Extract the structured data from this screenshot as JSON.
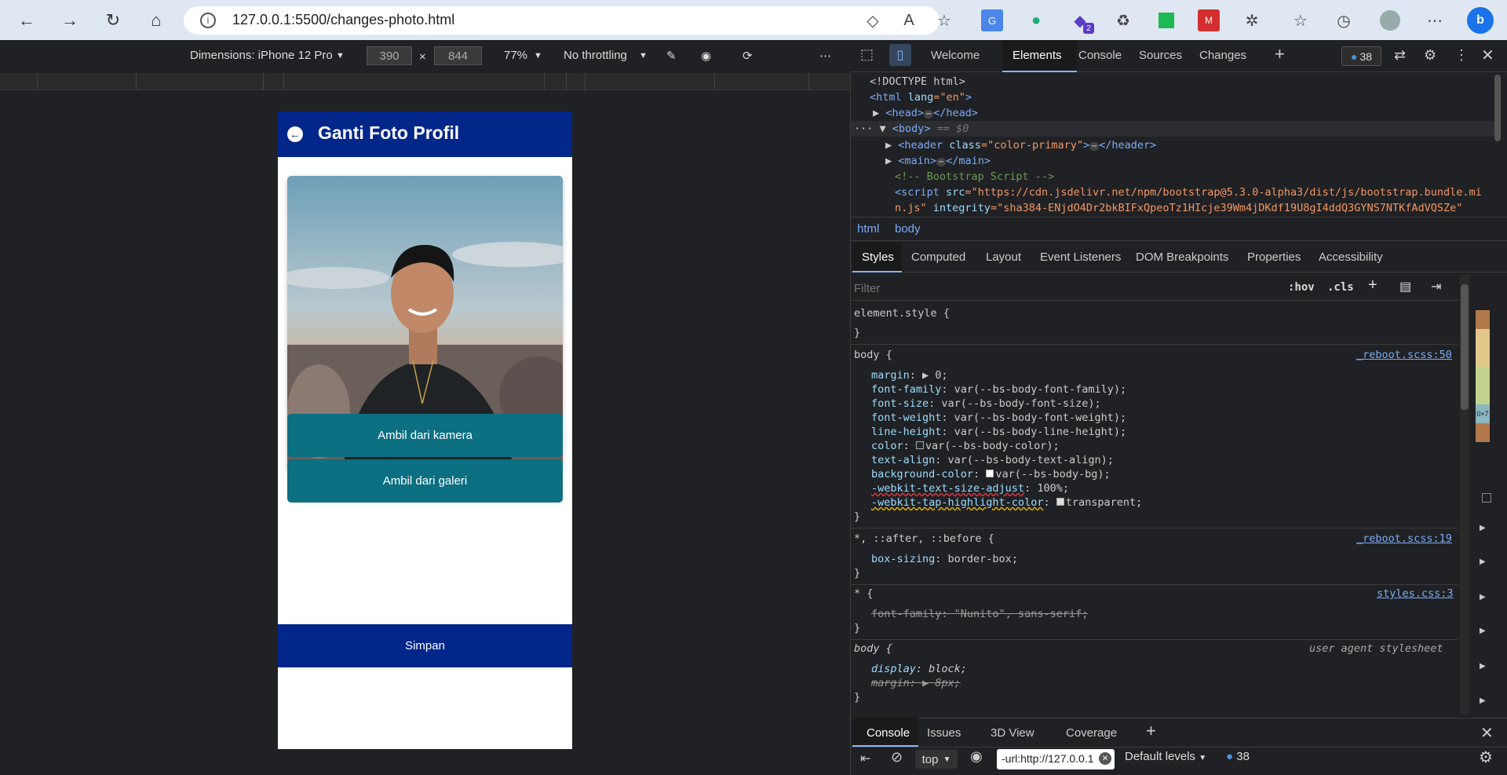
{
  "browser": {
    "url": "127.0.0.1:5500/changes-photo.html",
    "ext_badge": "2"
  },
  "devtoolbar": {
    "dimensions_label": "Dimensions: iPhone 12 Pro",
    "width": "390",
    "height": "844",
    "x": "×",
    "zoom": "77%",
    "throttling": "No throttling"
  },
  "phone": {
    "title": "Ganti Foto Profil",
    "btn_camera": "Ambil dari kamera",
    "btn_gallery": "Ambil dari galeri",
    "btn_save": "Simpan"
  },
  "devtools": {
    "tabs": [
      "Welcome",
      "Elements",
      "Console",
      "Sources",
      "Changes"
    ],
    "issues_count": "38",
    "dom_lines": {
      "l1": "<!DOCTYPE html>",
      "l2a": "<html ",
      "l2b": "lang",
      "l2c": "=\"en\"",
      "l2d": ">",
      "l3a": "<head>",
      "l3b": "</head>",
      "l4a": "<body>",
      "l4b": "== $0",
      "l5a": "<header ",
      "l5b": "class",
      "l5c": "=\"color-primary\"",
      "l5d": ">",
      "l5e": "</header>",
      "l6a": "<main>",
      "l6b": "</main>",
      "l7": "<!-- Bootstrap Script -->",
      "l8a": "<script ",
      "l8b": "src",
      "l8c": "=\"https://cdn.jsdelivr.net/npm/bootstrap@5.3.0-alpha3/dist/js/bootstrap.bundle.mi",
      "l9a": "n.js\" ",
      "l9b": "integrity",
      "l9c": "=\"sha384-ENjdO4Dr2bkBIFxQpeoTz1HIcje39Wm4jDKdf19U8gI4ddQ3GYNS7NTKfAdVQSZe\""
    },
    "crumbs": [
      "html",
      "body"
    ],
    "style_tabs": [
      "Styles",
      "Computed",
      "Layout",
      "Event Listeners",
      "DOM Breakpoints",
      "Properties",
      "Accessibility"
    ],
    "filter_placeholder": "Filter",
    "hov": ":hov",
    "cls": ".cls",
    "rules": {
      "r0a": "element.style {",
      "r0b": "}",
      "r1sel": "body {",
      "r1src": "_reboot.scss:50",
      "r1": [
        [
          "margin",
          ": ",
          "▶ 0;"
        ],
        [
          "font-family",
          ": ",
          "var(--bs-body-font-family);"
        ],
        [
          "font-size",
          ": ",
          "var(--bs-body-font-size);"
        ],
        [
          "font-weight",
          ": ",
          "var(--bs-body-font-weight);"
        ],
        [
          "line-height",
          ": ",
          "var(--bs-body-line-height);"
        ],
        [
          "color",
          ": ",
          "var(--bs-body-color);"
        ],
        [
          "text-align",
          ": ",
          "var(--bs-body-text-align);"
        ],
        [
          "background-color",
          ": ",
          "var(--bs-body-bg);"
        ],
        [
          "-webkit-text-size-adjust",
          ": ",
          "100%;"
        ],
        [
          "-webkit-tap-highlight-color",
          ": ",
          "transparent;"
        ]
      ],
      "close": "}",
      "r2sel": "*, ::after, ::before {",
      "r2src": "_reboot.scss:19",
      "r2p": "box-sizing",
      "r2v": ": border-box;",
      "r3sel": "* {",
      "r3src": "styles.css:3",
      "r3line": "font-family: \"Nunito\", sans-serif;",
      "r4sel": "body {",
      "r4src": "user agent stylesheet",
      "r4p1": "display",
      "r4v1": ": block;",
      "r4line": "margin: ▶ 8px;"
    },
    "box_model_label": "0×7",
    "console_tabs": [
      "Console",
      "Issues",
      "3D View",
      "Coverage"
    ],
    "console_context": "top",
    "console_filter": "-url:http://127.0.0.1",
    "console_levels": "Default levels",
    "console_count": "38"
  }
}
